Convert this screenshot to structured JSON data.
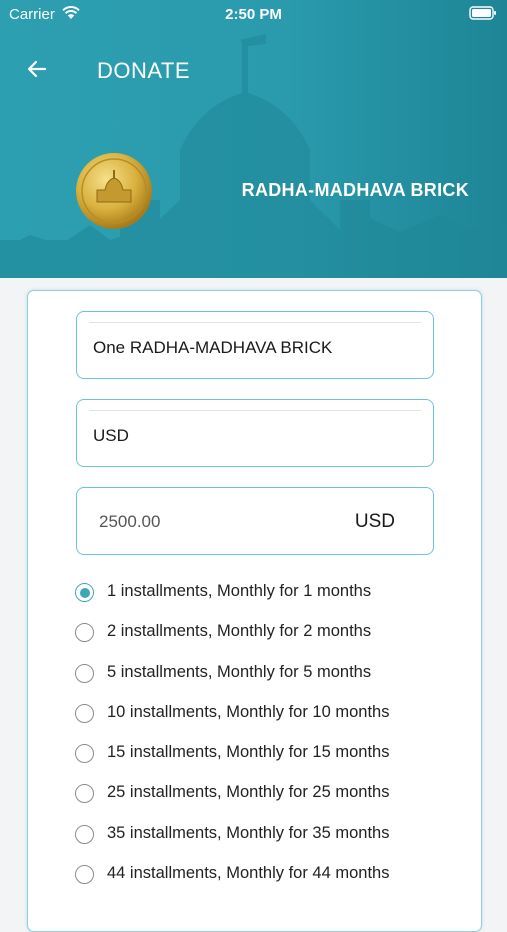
{
  "status_bar": {
    "carrier": "Carrier",
    "time": "2:50 PM"
  },
  "header": {
    "title": "DONATE",
    "brick_name": "RADHA-MADHAVA BRICK",
    "background_color": "#2a9bad"
  },
  "form": {
    "item_field": "One RADHA-MADHAVA BRICK",
    "currency_field": "USD",
    "amount": {
      "value": "2500.00",
      "currency": "USD"
    }
  },
  "installment_options": [
    {
      "label": "1 installments, Monthly for 1 months",
      "selected": true
    },
    {
      "label": "2 installments, Monthly for 2 months",
      "selected": false
    },
    {
      "label": "5 installments, Monthly for 5 months",
      "selected": false
    },
    {
      "label": "10 installments, Monthly for 10 months",
      "selected": false
    },
    {
      "label": "15 installments, Monthly for 15 months",
      "selected": false
    },
    {
      "label": "25 installments, Monthly for 25 months",
      "selected": false
    },
    {
      "label": "35 installments, Monthly for 35 months",
      "selected": false
    },
    {
      "label": "44 installments, Monthly for 44 months",
      "selected": false
    }
  ],
  "accent_color": "#3fa6ba"
}
